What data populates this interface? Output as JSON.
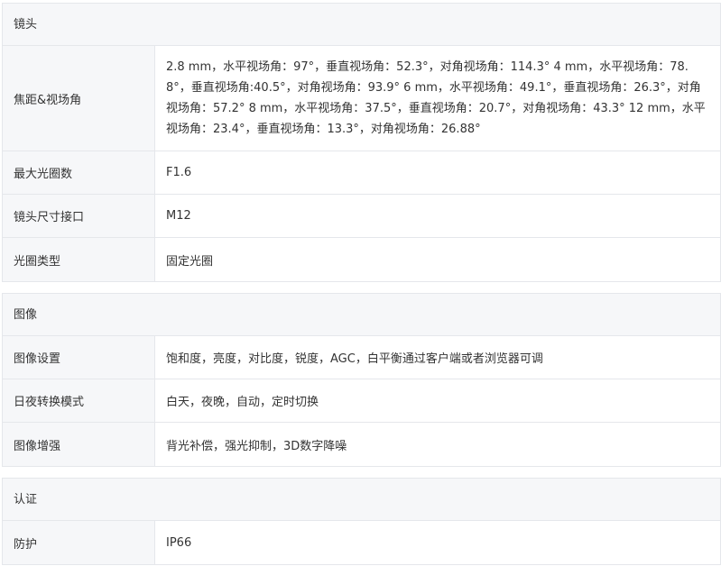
{
  "sections": [
    {
      "title": "镜头",
      "rows": [
        {
          "label": "焦距&视场角",
          "value": "2.8 mm，水平视场角：97°，垂直视场角：52.3°，对角视场角：114.3° 4 mm，水平视场角：78.8°，垂直视场角:40.5°，对角视场角：93.9° 6 mm，水平视场角：49.1°，垂直视场角：26.3°，对角视场角：57.2° 8 mm，水平视场角：37.5°，垂直视场角：20.7°，对角视场角：43.3° 12 mm，水平视场角：23.4°，垂直视场角：13.3°，对角视场角：26.88°"
        },
        {
          "label": "最大光圈数",
          "value": "F1.6"
        },
        {
          "label": "镜头尺寸接口",
          "value": "M12"
        },
        {
          "label": "光圈类型",
          "value": "固定光圈"
        }
      ]
    },
    {
      "title": "图像",
      "rows": [
        {
          "label": "图像设置",
          "value": "饱和度，亮度，对比度，锐度，AGC，白平衡通过客户端或者浏览器可调"
        },
        {
          "label": "日夜转换模式",
          "value": "白天，夜晚，自动，定时切换"
        },
        {
          "label": "图像增强",
          "value": "背光补偿，强光抑制，3D数字降噪"
        }
      ]
    },
    {
      "title": "认证",
      "rows": [
        {
          "label": "防护",
          "value": "IP66"
        }
      ]
    }
  ]
}
